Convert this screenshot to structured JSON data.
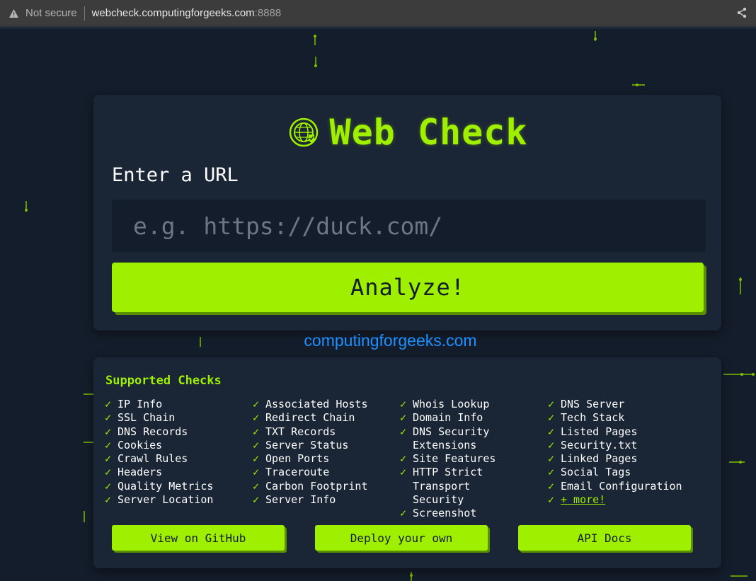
{
  "browser": {
    "security_label": "Not secure",
    "url_host": "webcheck.computingforgeeks.com",
    "url_port": ":8888"
  },
  "hero": {
    "title": "Web Check",
    "url_label": "Enter a URL",
    "url_placeholder": "e.g. https://duck.com/",
    "url_value": "",
    "analyze_label": "Analyze!"
  },
  "site_link": "computingforgeeks.com",
  "checks": {
    "title": "Supported Checks",
    "tick": "✓",
    "columns": [
      [
        "IP Info",
        "SSL Chain",
        "DNS Records",
        "Cookies",
        "Crawl Rules",
        "Headers",
        "Quality Metrics",
        "Server Location"
      ],
      [
        "Associated Hosts",
        "Redirect Chain",
        "TXT Records",
        "Server Status",
        "Open Ports",
        "Traceroute",
        "Carbon Footprint",
        "Server Info"
      ],
      [
        "Whois Lookup",
        "Domain Info",
        "DNS Security Extensions",
        "Site Features",
        "HTTP Strict Transport Security",
        "Screenshot"
      ],
      [
        "DNS Server",
        "Tech Stack",
        "Listed Pages",
        "Security.txt",
        "Linked Pages",
        "Social Tags",
        "Email Configuration",
        "+ more!"
      ]
    ]
  },
  "buttons": {
    "github": "View on GitHub",
    "deploy": "Deploy your own",
    "api": "API Docs"
  },
  "colors": {
    "accent": "#9fef00",
    "background": "#141d2b",
    "card": "#1a2535",
    "link": "#1e90ff"
  },
  "icons": {
    "warning": "warning-triangle-icon",
    "share": "share-icon",
    "logo": "globe-shield-icon"
  }
}
